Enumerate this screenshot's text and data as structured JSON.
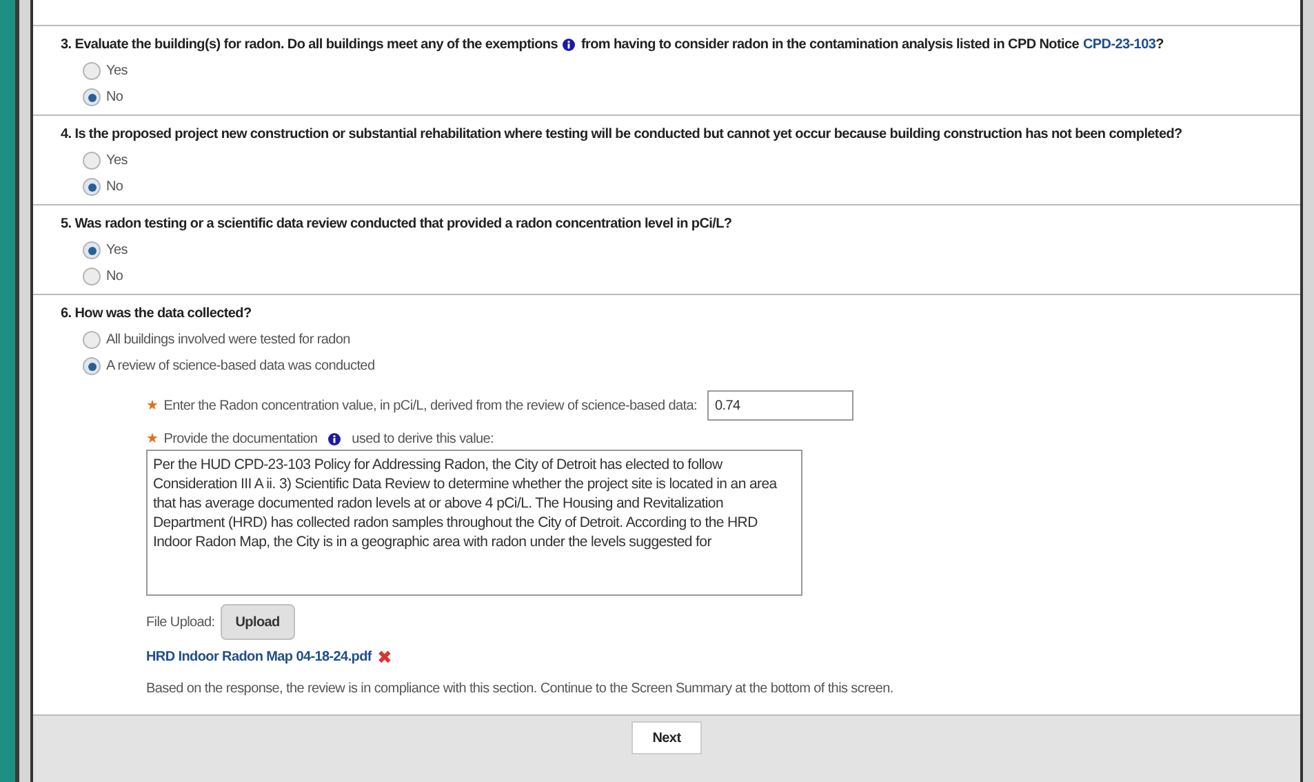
{
  "questions": [
    {
      "parts": [
        {
          "kind": "text",
          "text": "3. Evaluate the building(s) for radon. Do all buildings meet any of the exemptions"
        },
        {
          "kind": "info"
        },
        {
          "kind": "text",
          "text": "from having to consider radon in the contamination analysis listed in CPD Notice"
        },
        {
          "kind": "link",
          "text": "CPD-23-103"
        },
        {
          "kind": "text",
          "text": "?"
        }
      ],
      "options": [
        {
          "label": "Yes",
          "selected": false
        },
        {
          "label": "No",
          "selected": true
        }
      ]
    },
    {
      "parts": [
        {
          "kind": "text",
          "text": "4. Is the proposed project new construction or substantial rehabilitation where testing will be conducted but cannot yet occur because building construction has not been completed?"
        }
      ],
      "options": [
        {
          "label": "Yes",
          "selected": false
        },
        {
          "label": "No",
          "selected": true
        }
      ]
    },
    {
      "parts": [
        {
          "kind": "text",
          "text": "5. Was radon testing or a scientific data review conducted that provided a radon concentration level in pCi/L?"
        }
      ],
      "options": [
        {
          "label": "Yes",
          "selected": true
        },
        {
          "label": "No",
          "selected": false
        }
      ]
    },
    {
      "parts": [
        {
          "kind": "text",
          "text": "6. How was the data collected?"
        }
      ],
      "options": [
        {
          "label": "All buildings involved were tested for radon",
          "selected": false
        },
        {
          "label": "A review of science-based data was conducted",
          "selected": true
        }
      ]
    }
  ],
  "details": {
    "concentration_label": "Enter the Radon concentration value, in pCi/L, derived from the review of science-based data:",
    "concentration_value": "0.74",
    "required_mark": "★",
    "documentation_label_before": "Provide the documentation",
    "documentation_label_after": "used to derive this value:",
    "documentation_value": "Per the HUD CPD-23-103 Policy for Addressing Radon, the City of Detroit has elected to follow Consideration III A ii. 3) Scientific Data Review to determine whether the project site is located in an area that has average documented radon levels at or above 4 pCi/L. The Housing and Revitalization Department (HRD) has collected radon samples throughout the City of Detroit. According to the HRD Indoor Radon Map, the City is in a geographic area with radon under the levels suggested for",
    "file_upload_label": "File Upload:",
    "upload_button": "Upload",
    "file_name": "HRD Indoor Radon Map 04-18-24.pdf",
    "remove_mark": "✖",
    "compliance_note": "Based on the response, the review is in compliance with this section. Continue to the Screen Summary at the bottom of this screen."
  },
  "next_button": "Next"
}
